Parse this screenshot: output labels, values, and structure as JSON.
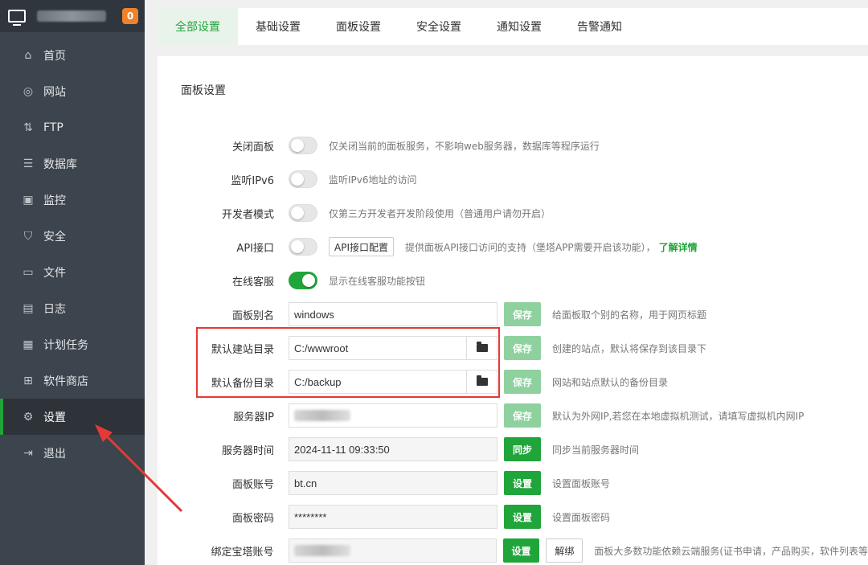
{
  "sidebar": {
    "badge": "0",
    "items": [
      {
        "label": "首页",
        "icon": "home-icon",
        "glyph": "⌂"
      },
      {
        "label": "网站",
        "icon": "globe-icon",
        "glyph": "◎"
      },
      {
        "label": "FTP",
        "icon": "ftp-icon",
        "glyph": "⇅"
      },
      {
        "label": "数据库",
        "icon": "database-icon",
        "glyph": "☰"
      },
      {
        "label": "监控",
        "icon": "monitor-chart-icon",
        "glyph": "▣"
      },
      {
        "label": "安全",
        "icon": "shield-icon",
        "glyph": "⛉"
      },
      {
        "label": "文件",
        "icon": "folder-icon",
        "glyph": "▭"
      },
      {
        "label": "日志",
        "icon": "log-icon",
        "glyph": "▤"
      },
      {
        "label": "计划任务",
        "icon": "schedule-icon",
        "glyph": "▦"
      },
      {
        "label": "软件商店",
        "icon": "app-store-icon",
        "glyph": "⊞"
      },
      {
        "label": "设置",
        "icon": "gear-icon",
        "glyph": "⚙"
      },
      {
        "label": "退出",
        "icon": "logout-icon",
        "glyph": "⇥"
      }
    ]
  },
  "tabs": [
    "全部设置",
    "基础设置",
    "面板设置",
    "安全设置",
    "通知设置",
    "告警通知"
  ],
  "panel": {
    "title": "面板设置",
    "toggles": [
      {
        "label": "关闭面板",
        "on": false,
        "desc": "仅关闭当前的面板服务，不影响web服务器，数据库等程序运行"
      },
      {
        "label": "监听IPv6",
        "on": false,
        "desc": "监听IPv6地址的访问"
      },
      {
        "label": "开发者模式",
        "on": false,
        "desc": "仅第三方开发者开发阶段使用（普通用户请勿开启）"
      },
      {
        "label": "API接口",
        "on": false,
        "button": "API接口配置",
        "desc": "提供面板API接口访问的支持（堡塔APP需要开启该功能），",
        "link": "了解详情"
      },
      {
        "label": "在线客服",
        "on": true,
        "desc": "显示在线客服功能按钮"
      }
    ],
    "alias": {
      "label": "面板别名",
      "value": "windows",
      "button": "保存",
      "hint": "给面板取个别的名称，用于网页标题"
    },
    "site_dir": {
      "label": "默认建站目录",
      "value": "C:/wwwroot",
      "button": "保存",
      "hint": "创建的站点，默认将保存到该目录下"
    },
    "backup_dir": {
      "label": "默认备份目录",
      "value": "C:/backup",
      "button": "保存",
      "hint": "网站和站点默认的备份目录"
    },
    "server_ip": {
      "label": "服务器IP",
      "button": "保存",
      "hint": "默认为外网IP,若您在本地虚拟机测试，请填写虚拟机内网IP"
    },
    "server_time": {
      "label": "服务器时间",
      "value": "2024-11-11 09:33:50",
      "button": "同步",
      "hint": "同步当前服务器时间"
    },
    "account": {
      "label": "面板账号",
      "value": "bt.cn",
      "button": "设置",
      "hint": "设置面板账号"
    },
    "password": {
      "label": "面板密码",
      "value": "********",
      "button": "设置",
      "hint": "设置面板密码"
    },
    "bind": {
      "label": "绑定宝塔账号",
      "button": "设置",
      "button2": "解绑",
      "hint": "面板大多数功能依赖云端服务(证书申请，产品购买，软件列表等"
    }
  }
}
